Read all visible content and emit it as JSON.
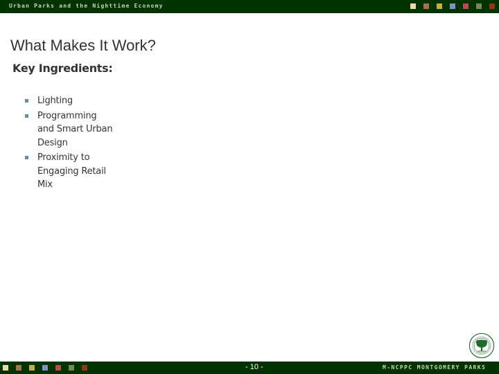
{
  "header": {
    "title": "Urban Parks and the Nighttime Economy",
    "squares": [
      {
        "name": "cream",
        "color": "#e8dca0"
      },
      {
        "name": "brown",
        "color": "#a8704c"
      },
      {
        "name": "mustard",
        "color": "#c8b040"
      },
      {
        "name": "blue",
        "color": "#8090c8"
      },
      {
        "name": "red",
        "color": "#c04850"
      },
      {
        "name": "olive",
        "color": "#788850"
      },
      {
        "name": "rust",
        "color": "#903810"
      }
    ]
  },
  "slide": {
    "title": "What Makes It Work?",
    "subtitle": "Key Ingredients:",
    "bullets": [
      "Lighting",
      "Programming and Smart Urban Design",
      "Proximity to Engaging Retail Mix"
    ]
  },
  "footer": {
    "page": "- 10 -",
    "organization": "M-NCPPC MONTGOMERY PARKS"
  },
  "colors": {
    "bar": "#003300",
    "logo_green": "#1e6b2e"
  }
}
